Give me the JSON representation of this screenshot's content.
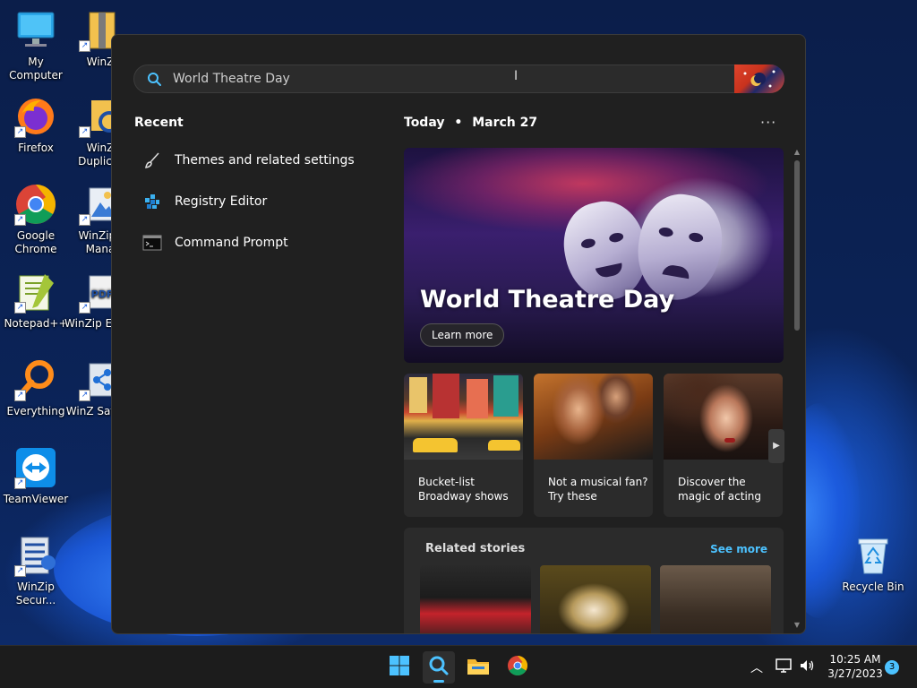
{
  "desktop": {
    "icons": [
      {
        "label": "My Computer",
        "icon": "computer-icon"
      },
      {
        "label": "WinZ",
        "icon": "winzip-icon"
      },
      {
        "label": "Firefox",
        "icon": "firefox-icon"
      },
      {
        "label": "WinZ Duplicat",
        "icon": "winzip-duplicate-icon"
      },
      {
        "label": "Google Chrome",
        "icon": "chrome-icon"
      },
      {
        "label": "WinZip I Mana",
        "icon": "winzip-image-manager-icon"
      },
      {
        "label": "Notepad++",
        "icon": "notepadpp-icon"
      },
      {
        "label": "WinZip Expre",
        "icon": "winzip-pdf-express-icon"
      },
      {
        "label": "Everything",
        "icon": "everything-icon"
      },
      {
        "label": "WinZ SafeSh",
        "icon": "winzip-safeshare-icon"
      },
      {
        "label": "TeamViewer",
        "icon": "teamviewer-icon"
      },
      {
        "label": "WinZip Secur...",
        "icon": "winzip-secure-icon"
      },
      {
        "label": "Recycle Bin",
        "icon": "recycle-bin-icon"
      }
    ]
  },
  "search": {
    "query": "World Theatre Day"
  },
  "recent": {
    "heading": "Recent",
    "items": [
      {
        "label": "Themes and related settings",
        "icon": "brush-icon"
      },
      {
        "label": "Registry Editor",
        "icon": "registry-editor-icon"
      },
      {
        "label": "Command Prompt",
        "icon": "command-prompt-icon"
      }
    ]
  },
  "today": {
    "heading": "Today",
    "separator": "•",
    "date": "March 27",
    "more": "···"
  },
  "hero": {
    "title": "World Theatre Day",
    "button": "Learn more"
  },
  "cards": [
    {
      "caption_line1": "Bucket-list",
      "caption_line2": "Broadway shows"
    },
    {
      "caption_line1": "Not a musical fan?",
      "caption_line2": "Try these"
    },
    {
      "caption_line1": "Discover the",
      "caption_line2": "magic of acting"
    }
  ],
  "related": {
    "title": "Related stories",
    "see_more": "See more"
  },
  "taskbar": {
    "time": "10:25 AM",
    "date": "3/27/2023",
    "notification_count": "3"
  },
  "colors": {
    "accent": "#4cc2ff",
    "panel_bg": "#202020",
    "card_bg": "#2b2b2b"
  }
}
